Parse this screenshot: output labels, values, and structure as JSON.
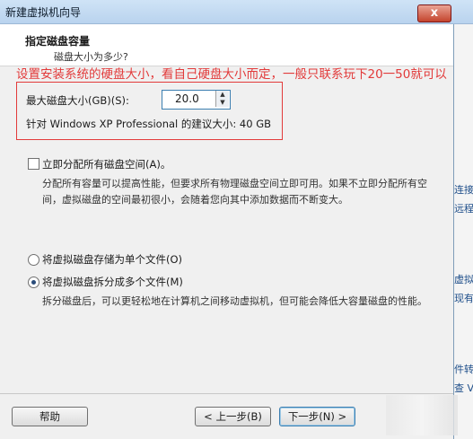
{
  "window": {
    "title": "新建虚拟机向导",
    "close_label": "x"
  },
  "header": {
    "title": "指定磁盘容量",
    "subtitle": "磁盘大小为多少?"
  },
  "annotation": {
    "text": "设置安装系统的硬盘大小，看自己硬盘大小而定，一般只联系玩下20一50就可以"
  },
  "disk": {
    "max_size_label": "最大磁盘大小(GB)(S):",
    "max_size_value": "20.0",
    "recommend_text": "针对 Windows XP Professional 的建议大小: 40 GB"
  },
  "allocate": {
    "checkbox_label": "立即分配所有磁盘空间(A)。",
    "checked": false,
    "description": "分配所有容量可以提高性能，但要求所有物理磁盘空间立即可用。如果不立即分配所有空间，虚拟磁盘的空间最初很小，会随着您向其中添加数据而不断变大。"
  },
  "storage": {
    "option_single": "将虚拟磁盘存储为单个文件(O)",
    "option_multi": "将虚拟磁盘拆分成多个文件(M)",
    "selected": "multi",
    "multi_description": "拆分磁盘后，可以更轻松地在计算机之间移动虚拟机，但可能会降低大容量磁盘的性能。"
  },
  "footer": {
    "help_label": "帮助",
    "back_label": "< 上一步(B)",
    "next_label": "下一步(N) >"
  },
  "side_panel": {
    "lines": [
      "连接",
      "远程",
      "虚拟",
      "现有",
      "件转",
      "查 V"
    ]
  }
}
